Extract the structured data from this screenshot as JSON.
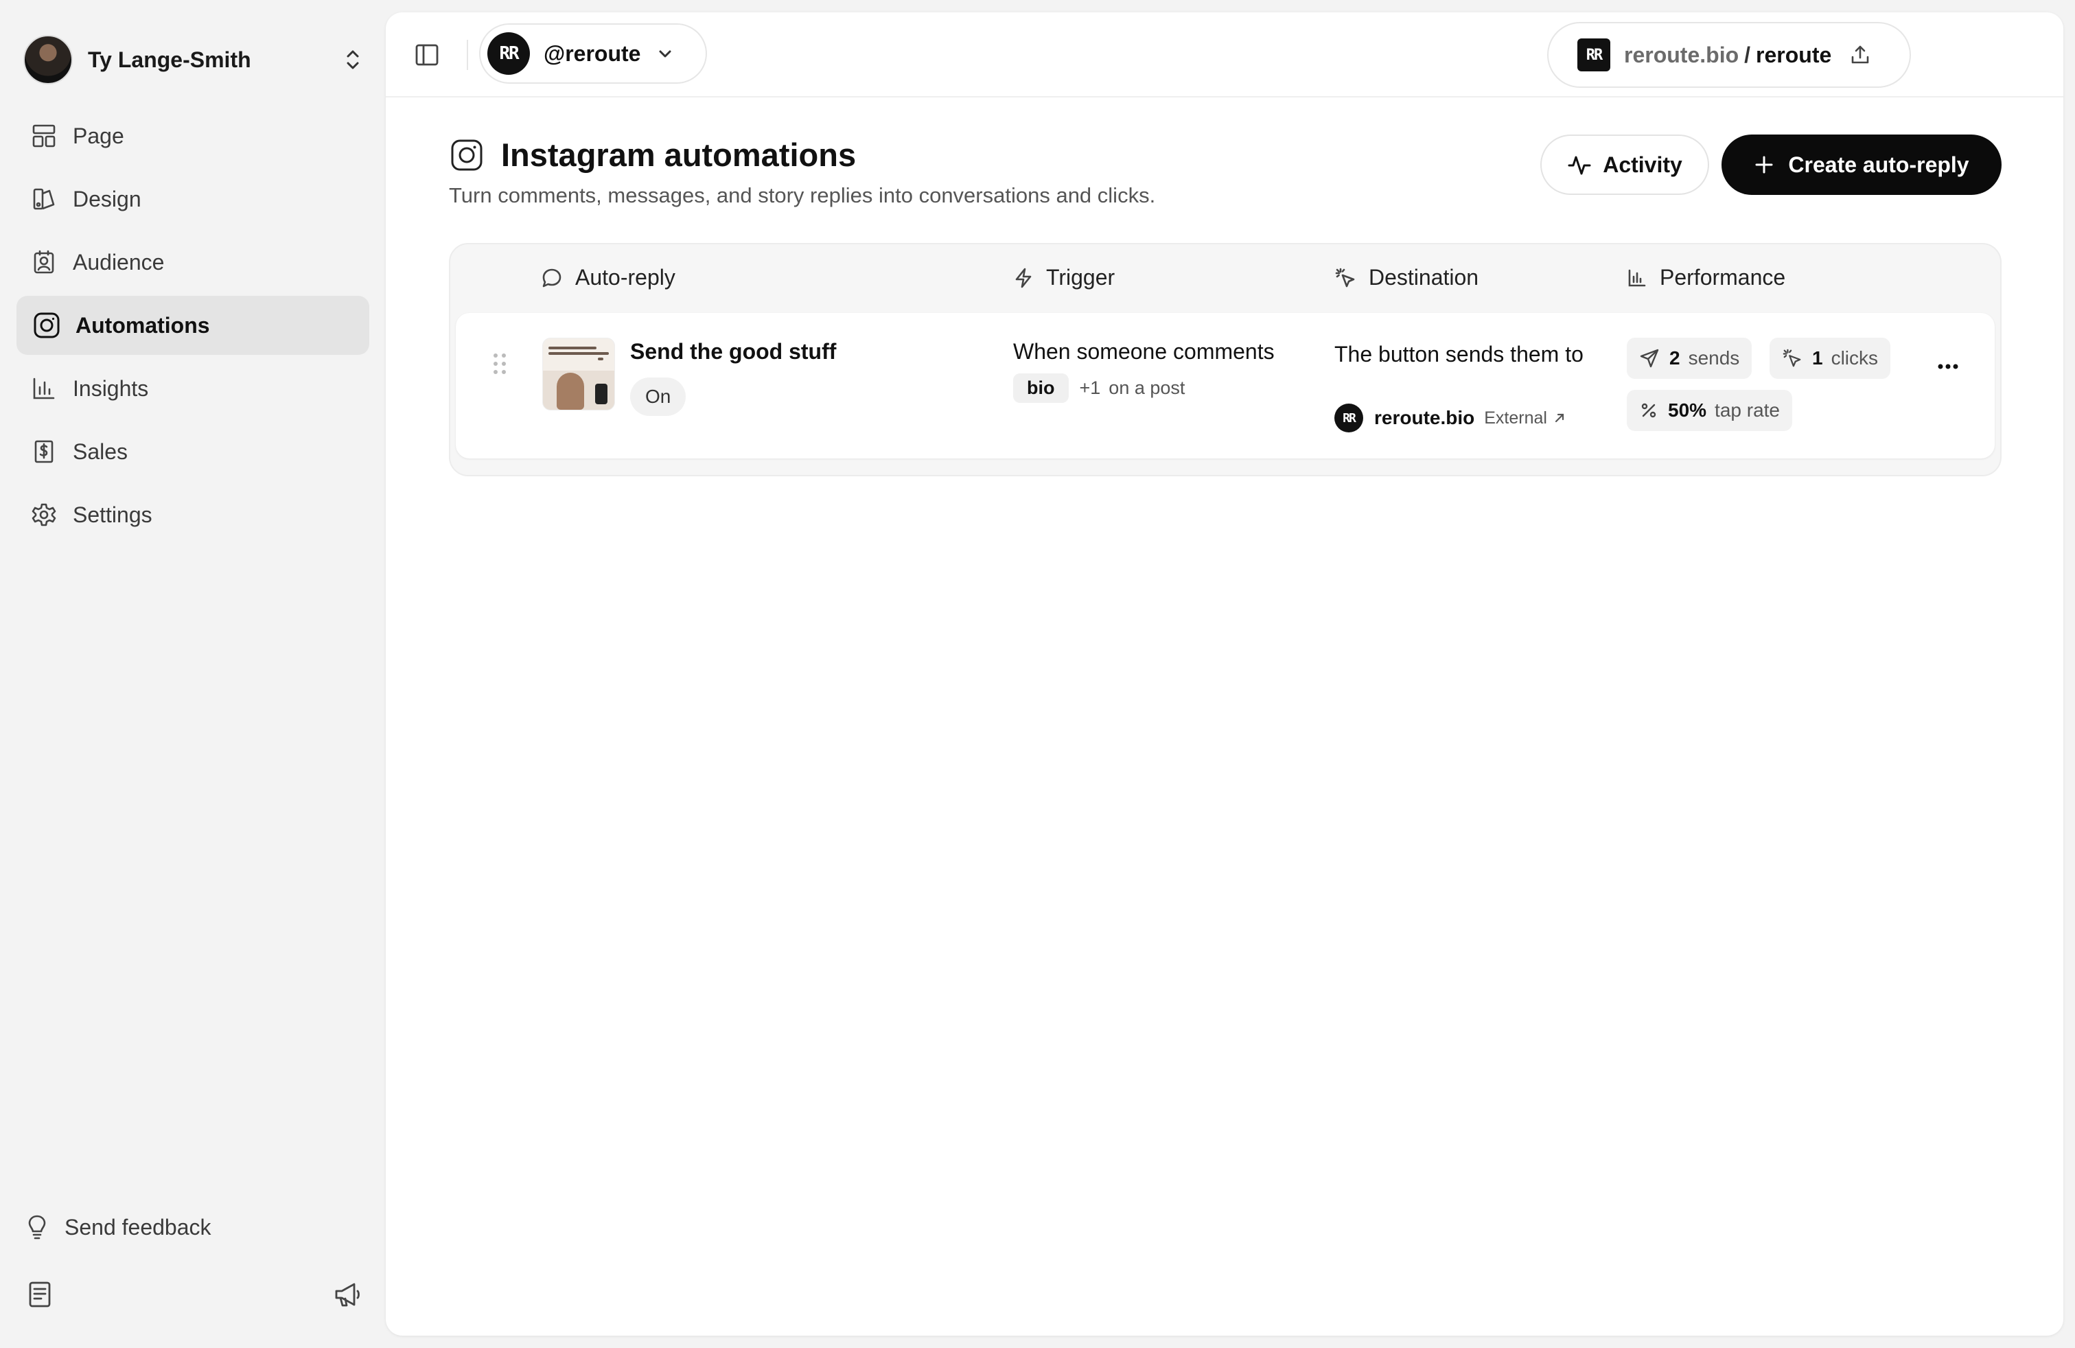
{
  "sidebar": {
    "account_name": "Ty Lange-Smith",
    "items": [
      {
        "label": "Page",
        "icon": "layout-icon"
      },
      {
        "label": "Design",
        "icon": "palette-icon"
      },
      {
        "label": "Audience",
        "icon": "contact-icon"
      },
      {
        "label": "Automations",
        "icon": "instagram-icon",
        "active": true
      },
      {
        "label": "Insights",
        "icon": "bar-chart-icon"
      },
      {
        "label": "Sales",
        "icon": "receipt-dollar-icon"
      },
      {
        "label": "Settings",
        "icon": "gear-icon"
      }
    ],
    "feedback_label": "Send feedback"
  },
  "topbar": {
    "logo_text": "RR",
    "handle": "@reroute",
    "url_domain": "reroute.bio",
    "url_separator": "/",
    "url_path": "reroute"
  },
  "header": {
    "title": "Instagram automations",
    "subtitle": "Turn comments, messages, and story replies into conversations and clicks.",
    "activity_label": "Activity",
    "create_label": "Create auto-reply"
  },
  "table": {
    "columns": [
      "Auto-reply",
      "Trigger",
      "Destination",
      "Performance"
    ],
    "rows": [
      {
        "name": "Send the good stuff",
        "status": "On",
        "trigger_text": "When someone comments",
        "keyword": "bio",
        "more_keywords": "+1",
        "trigger_context": "on a post",
        "destination_text": "The button sends them to",
        "destination_logo": "RR",
        "destination_domain": "reroute.bio",
        "destination_type": "External",
        "sends": "2",
        "sends_label": "sends",
        "clicks": "1",
        "clicks_label": "clicks",
        "tap_rate": "50%",
        "tap_rate_label": "tap rate"
      }
    ]
  },
  "colors": {
    "accent": "#0b0b0b",
    "background": "#f3f3f3",
    "panel": "#ffffff",
    "active_nav": "#e4e4e4"
  }
}
